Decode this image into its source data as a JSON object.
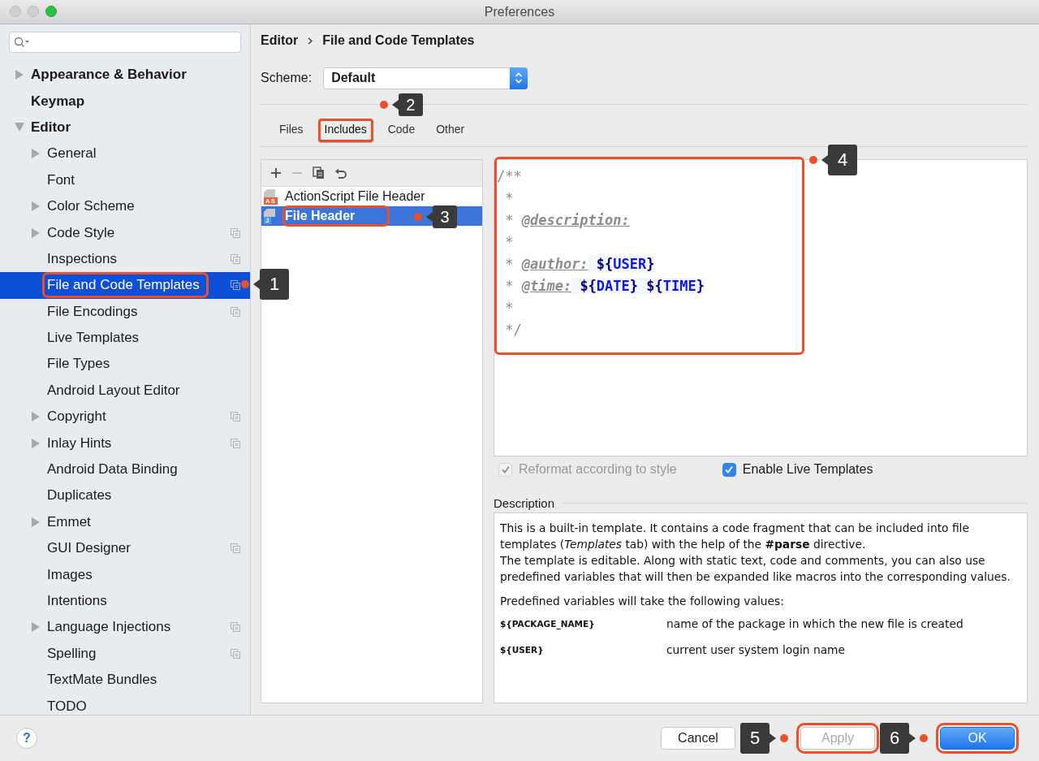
{
  "window": {
    "title": "Preferences"
  },
  "sidebar": {
    "items": [
      {
        "label": "Appearance & Behavior",
        "expandable": true,
        "expanded": false,
        "selected": false,
        "shared": false
      },
      {
        "label": "Keymap",
        "expandable": false,
        "selected": false,
        "shared": false
      },
      {
        "label": "Editor",
        "expandable": true,
        "expanded": true,
        "selected": false,
        "shared": false,
        "children": [
          {
            "label": "General",
            "expandable": true,
            "expanded": false,
            "selected": false,
            "shared": false
          },
          {
            "label": "Font",
            "expandable": false,
            "selected": false,
            "shared": false
          },
          {
            "label": "Color Scheme",
            "expandable": true,
            "expanded": false,
            "selected": false,
            "shared": false
          },
          {
            "label": "Code Style",
            "expandable": true,
            "expanded": false,
            "selected": false,
            "shared": true
          },
          {
            "label": "Inspections",
            "expandable": false,
            "selected": false,
            "shared": true
          },
          {
            "label": "File and Code Templates",
            "expandable": false,
            "selected": true,
            "shared": true,
            "callout": "1"
          },
          {
            "label": "File Encodings",
            "expandable": false,
            "selected": false,
            "shared": true
          },
          {
            "label": "Live Templates",
            "expandable": false,
            "selected": false,
            "shared": false
          },
          {
            "label": "File Types",
            "expandable": false,
            "selected": false,
            "shared": false
          },
          {
            "label": "Android Layout Editor",
            "expandable": false,
            "selected": false,
            "shared": false
          },
          {
            "label": "Copyright",
            "expandable": true,
            "expanded": false,
            "selected": false,
            "shared": true
          },
          {
            "label": "Inlay Hints",
            "expandable": true,
            "expanded": false,
            "selected": false,
            "shared": true
          },
          {
            "label": "Android Data Binding",
            "expandable": false,
            "selected": false,
            "shared": false
          },
          {
            "label": "Duplicates",
            "expandable": false,
            "selected": false,
            "shared": false
          },
          {
            "label": "Emmet",
            "expandable": true,
            "expanded": false,
            "selected": false,
            "shared": false
          },
          {
            "label": "GUI Designer",
            "expandable": false,
            "selected": false,
            "shared": true
          },
          {
            "label": "Images",
            "expandable": false,
            "selected": false,
            "shared": false
          },
          {
            "label": "Intentions",
            "expandable": false,
            "selected": false,
            "shared": false
          },
          {
            "label": "Language Injections",
            "expandable": true,
            "expanded": false,
            "selected": false,
            "shared": true
          },
          {
            "label": "Spelling",
            "expandable": false,
            "selected": false,
            "shared": true
          },
          {
            "label": "TextMate Bundles",
            "expandable": false,
            "selected": false,
            "shared": false
          },
          {
            "label": "TODO",
            "expandable": false,
            "selected": false,
            "shared": false
          }
        ]
      }
    ]
  },
  "breadcrumb": [
    "Editor",
    "File and Code Templates"
  ],
  "scheme": {
    "label": "Scheme:",
    "value": "Default"
  },
  "tabs": [
    {
      "label": "Files",
      "selected": false
    },
    {
      "label": "Includes",
      "selected": true,
      "callout": "2"
    },
    {
      "label": "Code",
      "selected": false
    },
    {
      "label": "Other",
      "selected": false
    }
  ],
  "templates": [
    {
      "label": "ActionScript File Header",
      "badge": "AS",
      "color": "#e8603c",
      "selected": false
    },
    {
      "label": "File Header",
      "badge": "J",
      "color": "#4a9fe0",
      "selected": true,
      "callout": "3"
    }
  ],
  "editor": {
    "callout": "4",
    "lines": [
      [
        {
          "text": "/**",
          "kind": "comment"
        }
      ],
      [
        {
          "text": " *",
          "kind": "comment"
        }
      ],
      [
        {
          "text": " * ",
          "kind": "comment"
        },
        {
          "text": "@description:",
          "kind": "tag"
        }
      ],
      [
        {
          "text": " *",
          "kind": "comment"
        }
      ],
      [
        {
          "text": " * ",
          "kind": "comment"
        },
        {
          "text": "@author:",
          "kind": "tag"
        },
        {
          "text": " ${",
          "kind": "brace"
        },
        {
          "text": "USER",
          "kind": "var"
        },
        {
          "text": "}",
          "kind": "brace"
        }
      ],
      [
        {
          "text": " * ",
          "kind": "comment"
        },
        {
          "text": "@time:",
          "kind": "tag"
        },
        {
          "text": " ${",
          "kind": "brace"
        },
        {
          "text": "DATE",
          "kind": "var"
        },
        {
          "text": "}",
          "kind": "brace"
        },
        {
          "text": " ${",
          "kind": "brace"
        },
        {
          "text": "TIME",
          "kind": "var"
        },
        {
          "text": "}",
          "kind": "brace"
        }
      ],
      [
        {
          "text": " *",
          "kind": "comment"
        }
      ],
      [
        {
          "text": " */",
          "kind": "comment"
        }
      ]
    ]
  },
  "options": [
    {
      "label": "Reformat according to style",
      "checked": true,
      "disabled": true
    },
    {
      "label": "Enable Live Templates",
      "checked": true,
      "disabled": false
    }
  ],
  "description": {
    "title": "Description",
    "paragraphs": [
      "This is a built-in template. It contains a code fragment that can be included into file templates (*Templates* tab) with the help of the **#parse** directive.",
      "The template is editable. Along with static text, code and comments, you can also use predefined variables that will then be expanded like macros into the corresponding values.",
      "Predefined variables will take the following values:"
    ],
    "variables": [
      {
        "name": "${PACKAGE_NAME}",
        "meaning": "name of the package in which the new file is created"
      },
      {
        "name": "${USER}",
        "meaning": "current user system login name"
      }
    ]
  },
  "help_button": "?",
  "buttons": [
    {
      "label": "Cancel",
      "kind": "default",
      "disabled": false
    },
    {
      "label": "Apply",
      "kind": "default",
      "disabled": true,
      "callout": "5"
    },
    {
      "label": "OK",
      "kind": "primary",
      "disabled": false,
      "callout": "6"
    }
  ]
}
